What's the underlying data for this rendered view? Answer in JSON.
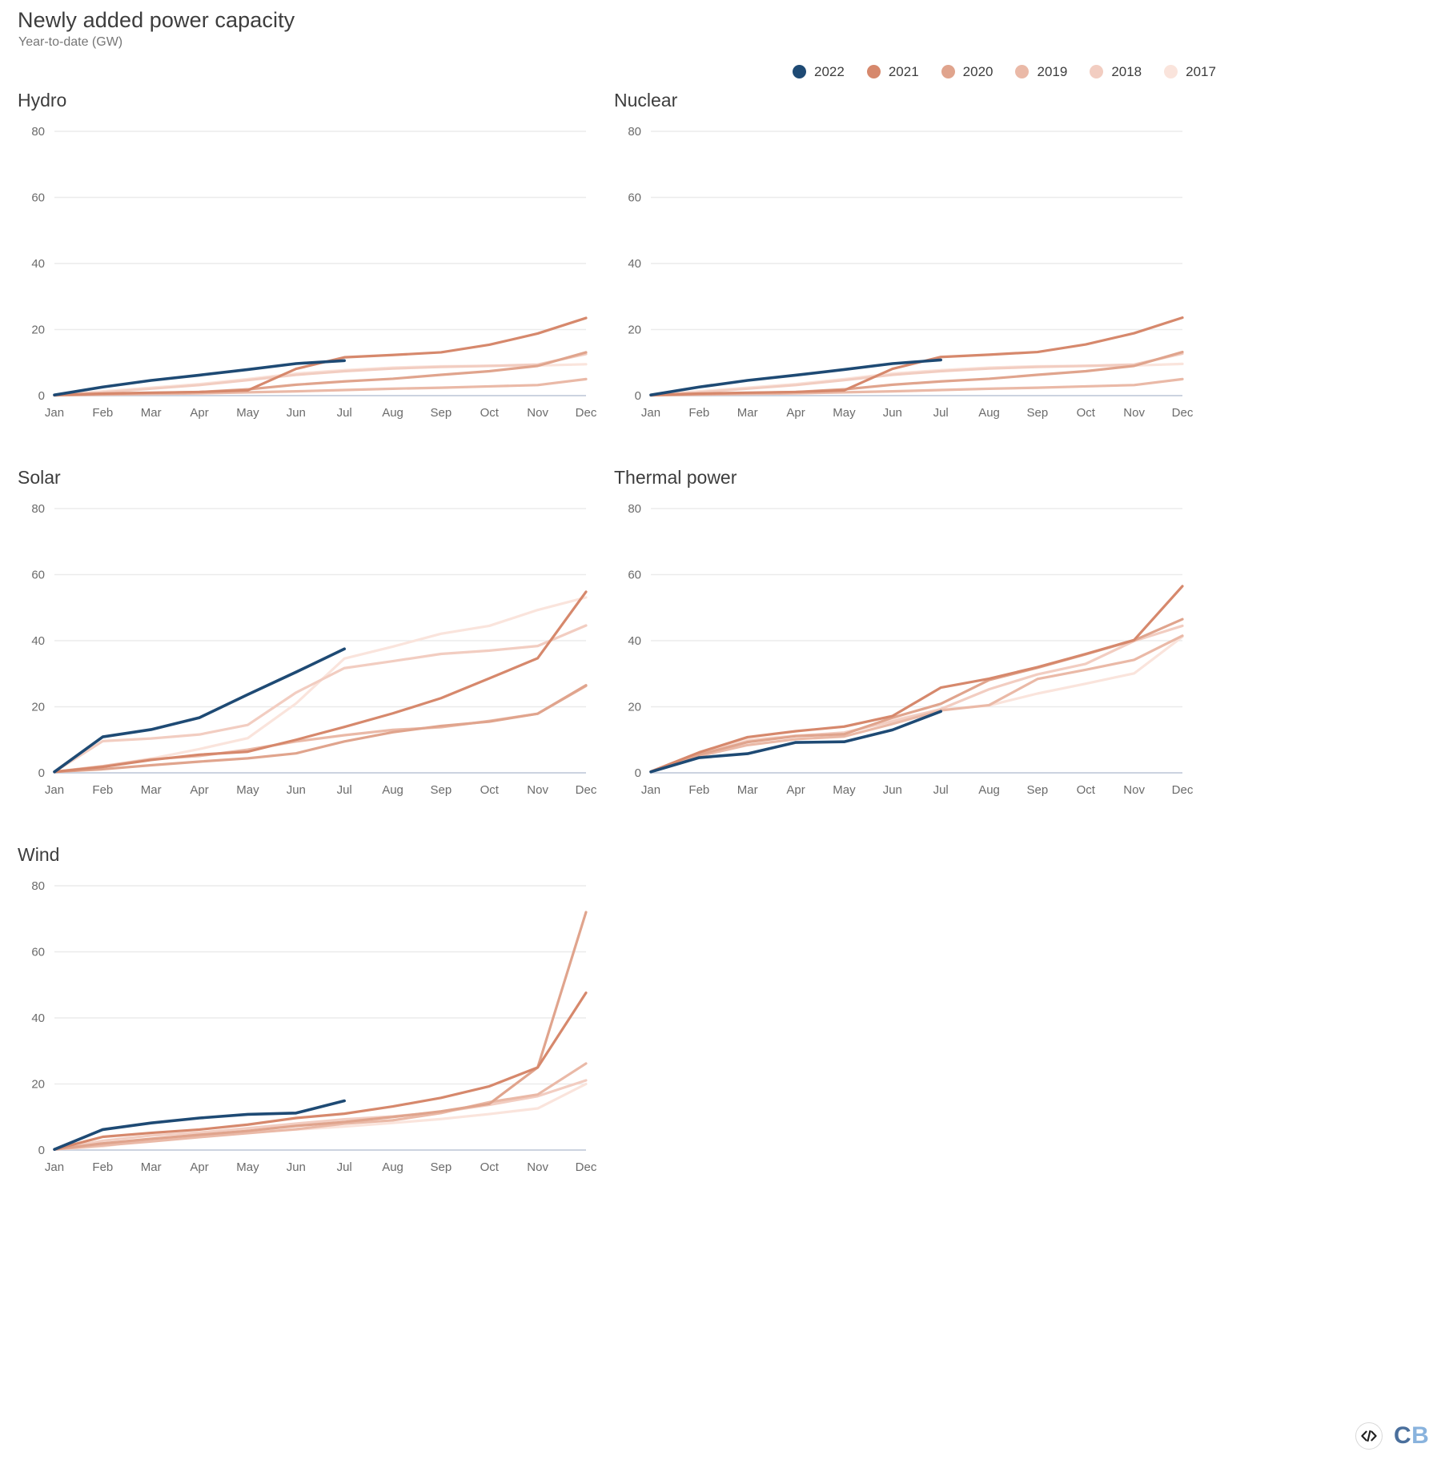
{
  "header": {
    "title": "Newly added power capacity",
    "subtitle": "Year-to-date (GW)"
  },
  "legend": {
    "items": [
      {
        "label": "2022",
        "color": "#1e4a74"
      },
      {
        "label": "2021",
        "color": "#d6886c"
      },
      {
        "label": "2020",
        "color": "#e0a48d"
      },
      {
        "label": "2019",
        "color": "#eab9a7"
      },
      {
        "label": "2018",
        "color": "#f2cdc1"
      },
      {
        "label": "2017",
        "color": "#fae4dc"
      }
    ]
  },
  "footer": {
    "embed_icon": "code-embed-icon",
    "brand_c": "C",
    "brand_b": "B"
  },
  "chart_data": [
    {
      "type": "line",
      "title": "Hydro",
      "xlabel": "",
      "ylabel": "Year-to-date (GW)",
      "categories": [
        "Jan",
        "Feb",
        "Mar",
        "Apr",
        "May",
        "Jun",
        "Jul",
        "Aug",
        "Sep",
        "Oct",
        "Nov",
        "Dec"
      ],
      "ylim": [
        0,
        80
      ],
      "yticks": [
        0,
        20,
        40,
        60,
        80
      ],
      "grid": true,
      "legend_position": "top",
      "series": [
        {
          "name": "2022",
          "color": "#1e4a74",
          "width": 3.6,
          "values": [
            0.2,
            2.6,
            4.6,
            6.2,
            7.9,
            9.7,
            10.6,
            null,
            null,
            null,
            null,
            null
          ]
        },
        {
          "name": "2021",
          "color": "#d6886c",
          "width": 3.2,
          "values": [
            0.2,
            0.6,
            0.9,
            1.1,
            1.6,
            8.1,
            11.6,
            12.3,
            13.1,
            15.4,
            18.8,
            23.5
          ]
        },
        {
          "name": "2020",
          "color": "#e0a48d",
          "width": 3.2,
          "values": [
            0.1,
            0.5,
            0.8,
            1.1,
            1.9,
            3.3,
            4.3,
            5.1,
            6.3,
            7.4,
            9.0,
            13.1
          ]
        },
        {
          "name": "2019",
          "color": "#eab9a7",
          "width": 3.2,
          "values": [
            0.1,
            0.3,
            0.5,
            0.7,
            1.0,
            1.3,
            1.7,
            2.1,
            2.4,
            2.8,
            3.2,
            5.0
          ]
        },
        {
          "name": "2018",
          "color": "#f2cdc1",
          "width": 3.2,
          "values": [
            0.2,
            1.0,
            2.1,
            3.2,
            4.7,
            6.3,
            7.4,
            8.2,
            8.7,
            9.0,
            9.4,
            12.6
          ]
        },
        {
          "name": "2017",
          "color": "#fae4dc",
          "width": 3.2,
          "values": [
            0.2,
            1.3,
            2.4,
            3.5,
            5.0,
            6.7,
            7.7,
            8.5,
            8.9,
            9.0,
            9.1,
            9.5
          ]
        }
      ]
    },
    {
      "type": "line",
      "title": "Nuclear",
      "xlabel": "",
      "ylabel": "Year-to-date (GW)",
      "categories": [
        "Jan",
        "Feb",
        "Mar",
        "Apr",
        "May",
        "Jun",
        "Jul",
        "Aug",
        "Sep",
        "Oct",
        "Nov",
        "Dec"
      ],
      "ylim": [
        0,
        80
      ],
      "yticks": [
        0,
        20,
        40,
        60,
        80
      ],
      "grid": true,
      "legend_position": "top",
      "series": [
        {
          "name": "2022",
          "color": "#1e4a74",
          "width": 3.6,
          "values": [
            0.2,
            2.6,
            4.6,
            6.2,
            7.9,
            9.7,
            10.8,
            null,
            null,
            null,
            null,
            null
          ]
        },
        {
          "name": "2021",
          "color": "#d6886c",
          "width": 3.2,
          "values": [
            0.2,
            0.6,
            0.9,
            1.1,
            1.6,
            8.1,
            11.7,
            12.4,
            13.2,
            15.5,
            18.9,
            23.6
          ]
        },
        {
          "name": "2020",
          "color": "#e0a48d",
          "width": 3.2,
          "values": [
            0.1,
            0.5,
            0.8,
            1.1,
            1.9,
            3.3,
            4.3,
            5.1,
            6.3,
            7.4,
            9.0,
            13.2
          ]
        },
        {
          "name": "2019",
          "color": "#eab9a7",
          "width": 3.2,
          "values": [
            0.1,
            0.3,
            0.5,
            0.7,
            1.0,
            1.3,
            1.7,
            2.1,
            2.4,
            2.8,
            3.2,
            5.0
          ]
        },
        {
          "name": "2018",
          "color": "#f2cdc1",
          "width": 3.2,
          "values": [
            0.2,
            1.0,
            2.1,
            3.2,
            4.7,
            6.3,
            7.4,
            8.2,
            8.7,
            9.0,
            9.4,
            12.7
          ]
        },
        {
          "name": "2017",
          "color": "#fae4dc",
          "width": 3.2,
          "values": [
            0.2,
            1.3,
            2.4,
            3.5,
            5.0,
            6.7,
            7.7,
            8.5,
            8.9,
            9.0,
            9.1,
            9.6
          ]
        }
      ]
    },
    {
      "type": "line",
      "title": "Solar",
      "xlabel": "",
      "ylabel": "Year-to-date (GW)",
      "categories": [
        "Jan",
        "Feb",
        "Mar",
        "Apr",
        "May",
        "Jun",
        "Jul",
        "Aug",
        "Sep",
        "Oct",
        "Nov",
        "Dec"
      ],
      "ylim": [
        0,
        80
      ],
      "yticks": [
        0,
        20,
        40,
        60,
        80
      ],
      "grid": true,
      "legend_position": "top",
      "series": [
        {
          "name": "2022",
          "color": "#1e4a74",
          "width": 3.6,
          "values": [
            0.3,
            10.9,
            13.1,
            16.7,
            23.7,
            30.5,
            37.5,
            null,
            null,
            null,
            null,
            null
          ]
        },
        {
          "name": "2021",
          "color": "#d6886c",
          "width": 3.2,
          "values": [
            0.3,
            1.8,
            3.9,
            5.5,
            6.4,
            10.0,
            13.9,
            18.0,
            22.6,
            28.6,
            34.7,
            54.8
          ]
        },
        {
          "name": "2020",
          "color": "#e0a48d",
          "width": 3.2,
          "values": [
            0.3,
            1.1,
            2.3,
            3.4,
            4.4,
            5.9,
            9.5,
            12.3,
            14.2,
            15.5,
            17.9,
            26.5
          ]
        },
        {
          "name": "2019",
          "color": "#eab9a7",
          "width": 3.2,
          "values": [
            0.3,
            2.0,
            4.1,
            5.1,
            7.0,
            9.5,
            11.4,
            13.0,
            13.8,
            15.7,
            17.9,
            26.3
          ]
        },
        {
          "name": "2018",
          "color": "#f2cdc1",
          "width": 3.2,
          "values": [
            0.3,
            9.6,
            10.4,
            11.6,
            14.5,
            24.3,
            31.7,
            33.8,
            36.0,
            37.0,
            38.4,
            44.6
          ]
        },
        {
          "name": "2017",
          "color": "#fae4dc",
          "width": 3.2,
          "values": [
            0.3,
            2.0,
            4.3,
            7.2,
            10.5,
            21.0,
            34.6,
            38.2,
            42.1,
            44.5,
            49.3,
            53.1
          ]
        }
      ]
    },
    {
      "type": "line",
      "title": "Thermal power",
      "xlabel": "",
      "ylabel": "Year-to-date (GW)",
      "categories": [
        "Jan",
        "Feb",
        "Mar",
        "Apr",
        "May",
        "Jun",
        "Jul",
        "Aug",
        "Sep",
        "Oct",
        "Nov",
        "Dec"
      ],
      "ylim": [
        0,
        80
      ],
      "yticks": [
        0,
        20,
        40,
        60,
        80
      ],
      "grid": true,
      "legend_position": "top",
      "series": [
        {
          "name": "2022",
          "color": "#1e4a74",
          "width": 3.6,
          "values": [
            0.3,
            4.6,
            5.8,
            9.2,
            9.4,
            13.0,
            18.6,
            null,
            null,
            null,
            null,
            null
          ]
        },
        {
          "name": "2021",
          "color": "#d6886c",
          "width": 3.2,
          "values": [
            0.4,
            6.2,
            10.8,
            12.6,
            14.0,
            17.2,
            25.8,
            28.5,
            32.0,
            36.0,
            40.2,
            56.5
          ]
        },
        {
          "name": "2020",
          "color": "#e0a48d",
          "width": 3.2,
          "values": [
            0.3,
            5.5,
            9.3,
            11.1,
            11.7,
            16.7,
            20.9,
            28.1,
            31.8,
            35.9,
            40.1,
            46.5
          ]
        },
        {
          "name": "2019",
          "color": "#eab9a7",
          "width": 3.2,
          "values": [
            0.3,
            5.1,
            8.4,
            10.2,
            11.0,
            14.8,
            18.9,
            20.5,
            28.4,
            31.2,
            34.2,
            41.5
          ]
        },
        {
          "name": "2018",
          "color": "#f2cdc1",
          "width": 3.2,
          "values": [
            0.3,
            5.6,
            9.6,
            11.2,
            12.2,
            15.6,
            19.3,
            25.3,
            29.8,
            33.0,
            39.9,
            44.5
          ]
        },
        {
          "name": "2017",
          "color": "#fae4dc",
          "width": 3.2,
          "values": [
            0.3,
            5.8,
            10.0,
            11.3,
            11.9,
            16.0,
            19.1,
            20.4,
            24.0,
            27.0,
            30.1,
            41.2
          ]
        }
      ]
    },
    {
      "type": "line",
      "title": "Wind",
      "xlabel": "",
      "ylabel": "Year-to-date (GW)",
      "categories": [
        "Jan",
        "Feb",
        "Mar",
        "Apr",
        "May",
        "Jun",
        "Jul",
        "Aug",
        "Sep",
        "Oct",
        "Nov",
        "Dec"
      ],
      "ylim": [
        0,
        80
      ],
      "yticks": [
        0,
        20,
        40,
        60,
        80
      ],
      "grid": true,
      "legend_position": "top",
      "series": [
        {
          "name": "2022",
          "color": "#1e4a74",
          "width": 3.6,
          "values": [
            0.2,
            6.2,
            8.2,
            9.7,
            10.8,
            11.2,
            14.9,
            null,
            null,
            null,
            null,
            null
          ]
        },
        {
          "name": "2021",
          "color": "#d6886c",
          "width": 3.2,
          "values": [
            0.2,
            4.0,
            5.2,
            6.2,
            7.7,
            9.7,
            11.0,
            13.2,
            15.8,
            19.3,
            25.0,
            47.6
          ]
        },
        {
          "name": "2020",
          "color": "#e0a48d",
          "width": 3.2,
          "values": [
            0.2,
            2.0,
            3.4,
            4.6,
            5.8,
            7.3,
            8.5,
            10.0,
            11.7,
            14.0,
            25.0,
            72.0
          ]
        },
        {
          "name": "2019",
          "color": "#eab9a7",
          "width": 3.2,
          "values": [
            0.2,
            1.4,
            2.6,
            3.9,
            5.1,
            6.3,
            8.0,
            9.0,
            11.2,
            14.5,
            16.8,
            26.2
          ]
        },
        {
          "name": "2018",
          "color": "#f2cdc1",
          "width": 3.2,
          "values": [
            0.2,
            2.8,
            4.4,
            5.3,
            6.6,
            8.0,
            9.3,
            10.2,
            11.5,
            13.7,
            16.3,
            21.1
          ]
        },
        {
          "name": "2017",
          "color": "#fae4dc",
          "width": 3.2,
          "values": [
            0.2,
            1.1,
            3.1,
            4.4,
            5.3,
            6.2,
            7.1,
            8.2,
            9.4,
            10.9,
            12.6,
            20.0
          ]
        }
      ]
    }
  ]
}
